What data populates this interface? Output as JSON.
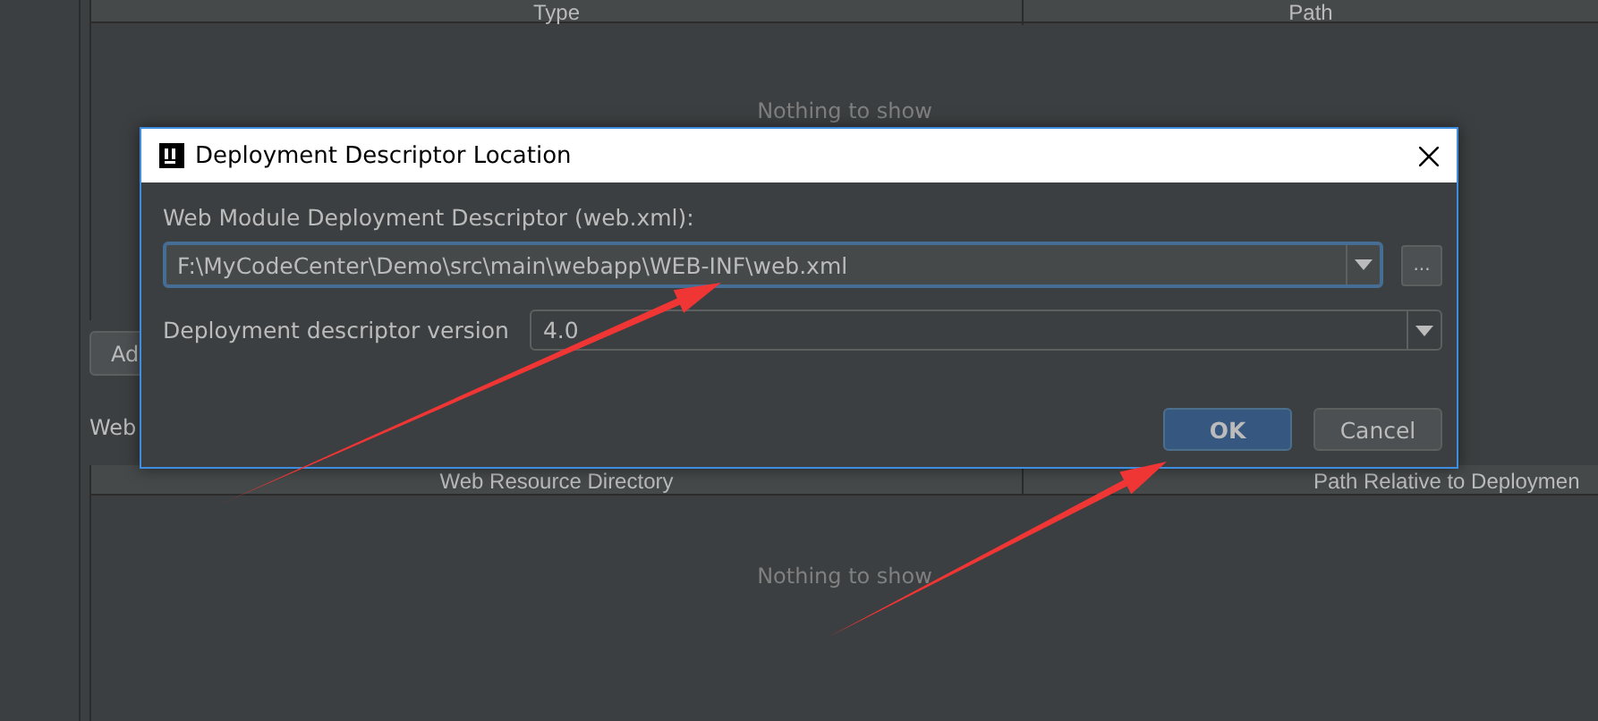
{
  "background": {
    "top_table": {
      "columns": [
        "Type",
        "Path"
      ],
      "empty_text": "Nothing to show"
    },
    "add_button": "Ad",
    "section_label": "Web",
    "bottom_table": {
      "columns": [
        "Web Resource Directory",
        "Path Relative to Deploymen"
      ],
      "empty_text": "Nothing to show"
    }
  },
  "dialog": {
    "title": "Deployment Descriptor Location",
    "descriptor_label": "Web Module Deployment Descriptor (web.xml):",
    "descriptor_value": "F:\\MyCodeCenter\\Demo\\src\\main\\webapp\\WEB-INF\\web.xml",
    "browse_button": "...",
    "version_label": "Deployment descriptor version",
    "version_value": "4.0",
    "buttons": [
      {
        "label": "OK",
        "default": true
      },
      {
        "label": "Cancel",
        "default": false
      }
    ]
  },
  "annotations": [
    {
      "kind": "arrow"
    },
    {
      "kind": "arrow"
    }
  ]
}
